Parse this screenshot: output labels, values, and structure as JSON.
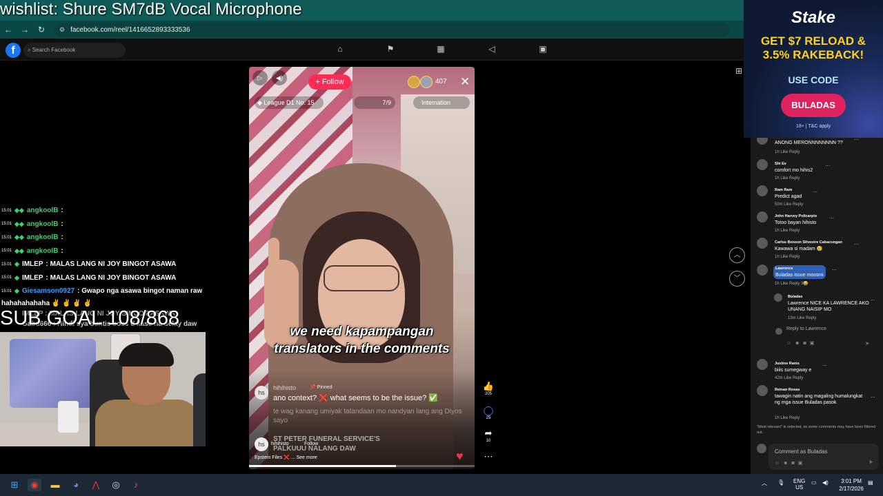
{
  "overlay": {
    "title": "wishlist: Shure SM7dB Vocal Microphone",
    "sub_goal": "SUB GOAL 108/868"
  },
  "browser": {
    "url": "facebook.com/reel/1416652893333536"
  },
  "facebook": {
    "search_placeholder": "Search Facebook",
    "logo": "f"
  },
  "ad": {
    "brand": "Stake",
    "line1": "GET $7 RELOAD &",
    "line2": "3.5% RAKEBACK!",
    "code_label": "USE CODE",
    "code": "BULADAS",
    "fine_print": "18+ | T&C apply",
    "brand_color": "#e0235e",
    "accent_color": "#ffd21a"
  },
  "chat": {
    "messages": [
      {
        "time": "15:01",
        "user": "angkoolB",
        "text": ":",
        "color": "#3bd16f"
      },
      {
        "time": "15:01",
        "user": "angkoolB",
        "text": ":",
        "color": "#3bd16f"
      },
      {
        "time": "15:01",
        "user": "angkoolB",
        "text": ":",
        "color": "#3bd16f"
      },
      {
        "time": "15:01",
        "user": "angkoolB",
        "text": ":",
        "color": "#3bd16f"
      },
      {
        "time": "15:01",
        "user": "IMLEP",
        "text": ": MALAS LANG NI JOY BINGOT ASAWA",
        "color": "#ffffff"
      },
      {
        "time": "15:01",
        "user": "IMLEP",
        "text": ": MALAS LANG NI JOY BINGOT ASAWA",
        "color": "#ffffff"
      },
      {
        "time": "15:01",
        "user": "Giesamson0927",
        "text": ": Gwapo nga asawa bingot naman raw",
        "color": "#3aa0ff"
      }
    ],
    "wrap_line": "hahahahahaha ✌ ✌ ✌ ✌",
    "overlap_line": "IMLEP : MALAS LANG NI JOY BINGOT ASAWA",
    "last_line": "Gabu666 : Hindi sya buntis boss d kase na delay daw"
  },
  "reel": {
    "follow_label": "+ Follow",
    "viewer_count": "407",
    "league": "League D1 No. 15",
    "rank": "7/9",
    "intermation": "Intemation",
    "caption_line1": "we need kapampangan",
    "caption_line2": "translators in the comments",
    "comment_user": "hihihisto",
    "pinned_label": "Pinned",
    "pinned_text": "ano context? ❌ what seems to be the issue? ✅",
    "faded_comment": "te wag kanang umiyak tatandaan mo nandyan lang ang Diyos sayo",
    "funeral_line1": "ST PETER FUNERAL SERVICE'S",
    "funeral_line2": "PALKUUU NALANG DAW",
    "creator_avatar": "hs",
    "creator_name": "hihihisto",
    "creator_follow": "Follow",
    "creator_desc": "Epstein Files ❌ ... See more",
    "progress": 0.65,
    "likes": "205",
    "comments": "25",
    "shares": "10"
  },
  "comments_panel": {
    "items": [
      {
        "name": "",
        "text": "ANONG MERONNNNNNNN ??",
        "meta": "1h   Like   Reply"
      },
      {
        "name": "Shi Ev",
        "text": "comfort mo hihis2",
        "meta": "1h   Like   Reply"
      },
      {
        "name": "Ram Ram",
        "text": "Predict agad",
        "meta": "50m   Like   Reply"
      },
      {
        "name": "John Harvey Policarpio",
        "text": "Totoo bayan hihisto",
        "meta": "1h   Like   Reply"
      },
      {
        "name": "Carlos Benson Silvestre Cabacungan",
        "text": "Kawawa si madam 😢",
        "meta": "1h   Like   Reply"
      },
      {
        "name": "Lawrence",
        "text": "Buladas issue mossmi",
        "meta": "1h   Like   Reply   3😄"
      },
      {
        "name": "Buladas",
        "text": "Lawrence NICE KA LAWRENCE AKO UNANG NAISIP MO",
        "meta": "13m   Like   Reply"
      },
      {
        "name": "Justine Ranis",
        "text": "biiis sumegway e",
        "meta": "42m   Like   Reply"
      },
      {
        "name": "Reinan Rosas",
        "text": "tawagin natin ang magaling humalungkat ng mga issue Buladas pasok",
        "meta": "1h   Like   Reply"
      }
    ],
    "reply_placeholder": "Reply to Lawrence",
    "filter_note": "\"Most relevant\" is selected, so some comments may have been filtered out.",
    "comment_as": "Comment as Buladas"
  },
  "taskbar": {
    "lang": "ENG",
    "region": "US",
    "time": "3:01 PM",
    "date": "2/17/2026"
  }
}
